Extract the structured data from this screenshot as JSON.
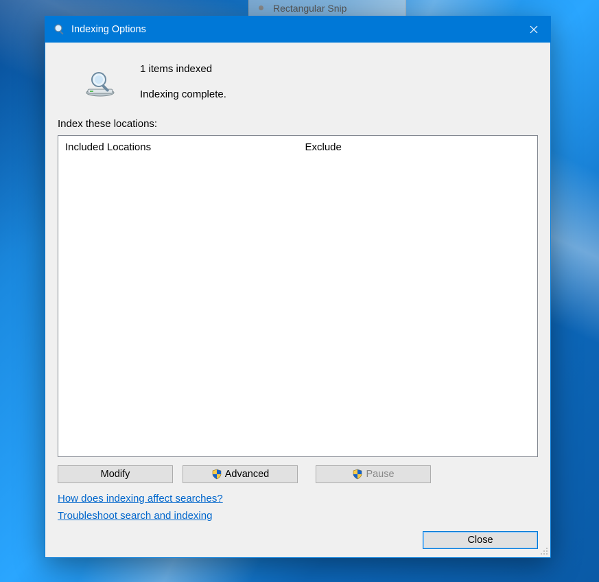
{
  "background": {
    "snip_label": "Rectangular Snip"
  },
  "titlebar": {
    "title": "Indexing Options"
  },
  "status": {
    "count_line": "1 items indexed",
    "state_line": "Indexing complete."
  },
  "locations": {
    "section_label": "Index these locations:",
    "col_included": "Included Locations",
    "col_exclude": "Exclude"
  },
  "buttons": {
    "modify": "Modify",
    "advanced": "Advanced",
    "pause": "Pause",
    "close": "Close"
  },
  "links": {
    "how": "How does indexing affect searches?",
    "troubleshoot": "Troubleshoot search and indexing"
  }
}
